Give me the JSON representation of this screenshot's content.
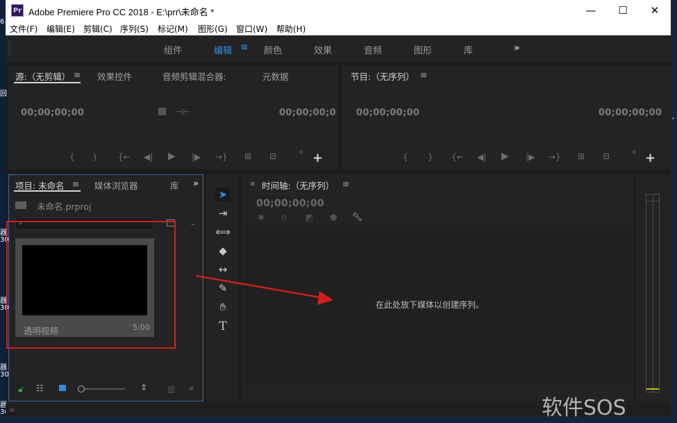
{
  "window": {
    "title": "Adobe Premiere Pro CC 2018 - E:\\prr\\未命名 *",
    "app_icon_text": "Pr",
    "minimize": "—",
    "maximize": "☐",
    "close": "✕"
  },
  "menu": [
    "文件(F)",
    "编辑(E)",
    "剪辑(C)",
    "序列(S)",
    "标记(M)",
    "图形(G)",
    "窗口(W)",
    "帮助(H)"
  ],
  "workspaces": {
    "items": [
      "组件",
      "编辑",
      "颜色",
      "效果",
      "音频",
      "图形",
      "库"
    ],
    "active": "编辑",
    "overflow": "»"
  },
  "source_panel": {
    "tabs": [
      "源:（无剪辑）",
      "效果控件",
      "音频剪辑混合器:",
      "元数据"
    ],
    "timecode_left": "00;00;00;00",
    "timecode_right": "00;00;00;0"
  },
  "program_panel": {
    "tab": "节目:（无序列）",
    "timecode_left": "00;00;00;00",
    "timecode_right": "00;00;00;00"
  },
  "project_panel": {
    "tabs": [
      "项目: 未命名",
      "媒体浏览器",
      "库"
    ],
    "file_name": "未命名.prproj",
    "search_placeholder": "",
    "item_name": "透明视频",
    "item_duration": "5:00"
  },
  "timeline_panel": {
    "tab": "时间轴:（无序列）",
    "close": "×",
    "timecode": "00;00;00;00",
    "drop_hint": "在此处放下媒体以创建序列。"
  },
  "desktop": {
    "left_labels": [
      "6",
      "回",
      "器",
      "30",
      "器",
      "30",
      "器",
      "30",
      "器",
      "30"
    ],
    "right_labels": [
      "'"
    ]
  },
  "watermark": "软件SOS",
  "colors": {
    "accent": "#2d8ceb",
    "annotation_red": "#d11f1f",
    "panel_bg": "#232323",
    "selected_panel_border": "#3c6aa8"
  },
  "icons": {
    "menu": "hamburger-icon",
    "search": "magnifier-icon",
    "folder": "folder-icon",
    "new_bin": "new-bin-icon"
  }
}
